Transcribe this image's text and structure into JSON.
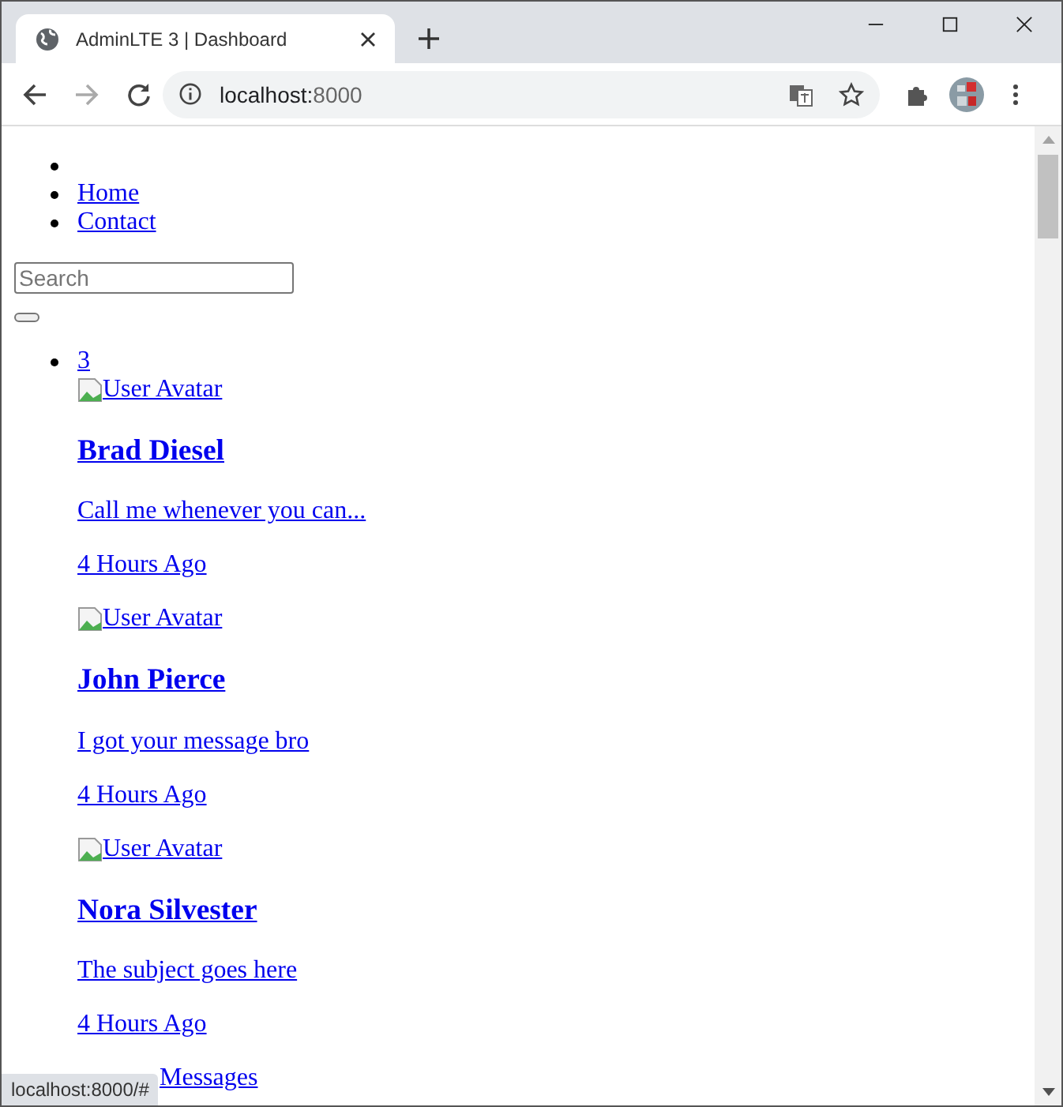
{
  "browser": {
    "tab_title": "AdminLTE 3 | Dashboard",
    "address_host": "localhost:",
    "address_port": "8000"
  },
  "page": {
    "nav_links": [
      "Home",
      "Contact"
    ],
    "search": {
      "placeholder": "Search"
    },
    "badge": "3",
    "messages": [
      {
        "avatar_alt": "User Avatar",
        "name": "Brad Diesel",
        "text": "Call me whenever you can...",
        "time": "4 Hours Ago"
      },
      {
        "avatar_alt": "User Avatar",
        "name": "John Pierce",
        "text": "I got your message bro",
        "time": "4 Hours Ago"
      },
      {
        "avatar_alt": "User Avatar",
        "name": "Nora Silvester",
        "text": "The subject goes here",
        "time": "4 Hours Ago"
      }
    ],
    "footer_link": "Messages"
  },
  "status_bar": "localhost:8000/#"
}
